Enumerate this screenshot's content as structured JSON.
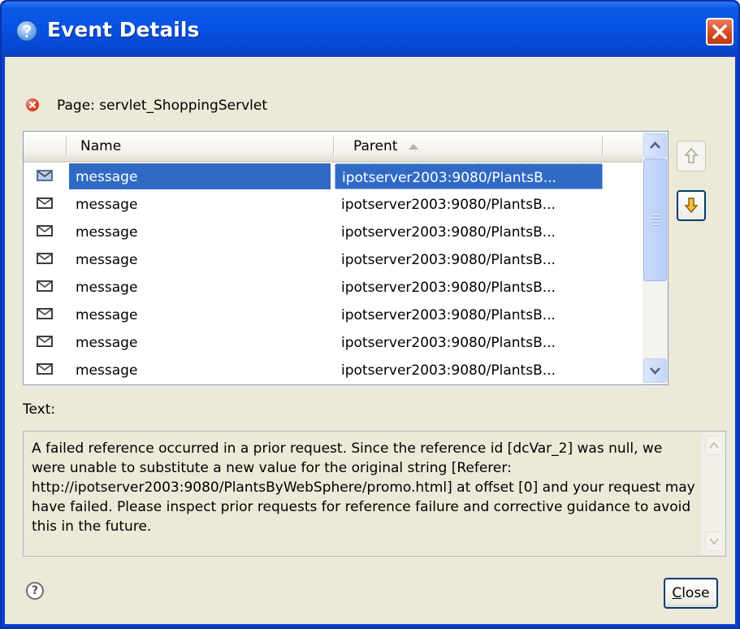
{
  "window": {
    "title": "Event Details"
  },
  "page": {
    "label": "Page: servlet_ShoppingServlet"
  },
  "table": {
    "columns": [
      "Name",
      "Parent"
    ],
    "rows": [
      {
        "name": "message",
        "parent": "ipotserver2003:9080/PlantsB...",
        "selected": true
      },
      {
        "name": "message",
        "parent": "ipotserver2003:9080/PlantsB..."
      },
      {
        "name": "message",
        "parent": "ipotserver2003:9080/PlantsB..."
      },
      {
        "name": "message",
        "parent": "ipotserver2003:9080/PlantsB..."
      },
      {
        "name": "message",
        "parent": "ipotserver2003:9080/PlantsB..."
      },
      {
        "name": "message",
        "parent": "ipotserver2003:9080/PlantsB..."
      },
      {
        "name": "message",
        "parent": "ipotserver2003:9080/PlantsB..."
      },
      {
        "name": "message",
        "parent": "ipotserver2003:9080/PlantsB..."
      }
    ],
    "sort_column": "Parent",
    "sort_direction": "ascending"
  },
  "text": {
    "label": "Text:",
    "body": "A failed reference occurred in a prior request.  Since the reference id [dcVar_2] was null, we were unable to substitute a new value for the original string [Referer: http://ipotserver2003:9080/PlantsByWebSphere/promo.html] at offset [0] and your request may have failed.  Please inspect prior requests for reference failure and corrective guidance to avoid this in the future."
  },
  "buttons": {
    "close_label": "Close",
    "close_mnemonic": "C",
    "close_rest": "lose"
  },
  "icons": {
    "title": "event-details-icon",
    "error": "error-icon",
    "row": "envelope-icon",
    "up": "arrow-up-icon",
    "down": "arrow-down-icon",
    "help": "help-icon"
  },
  "colors": {
    "titlebar": "#0751e2",
    "dialog_bg": "#ece9d8",
    "selection": "#316ac5",
    "close_x": "#d2471c"
  }
}
